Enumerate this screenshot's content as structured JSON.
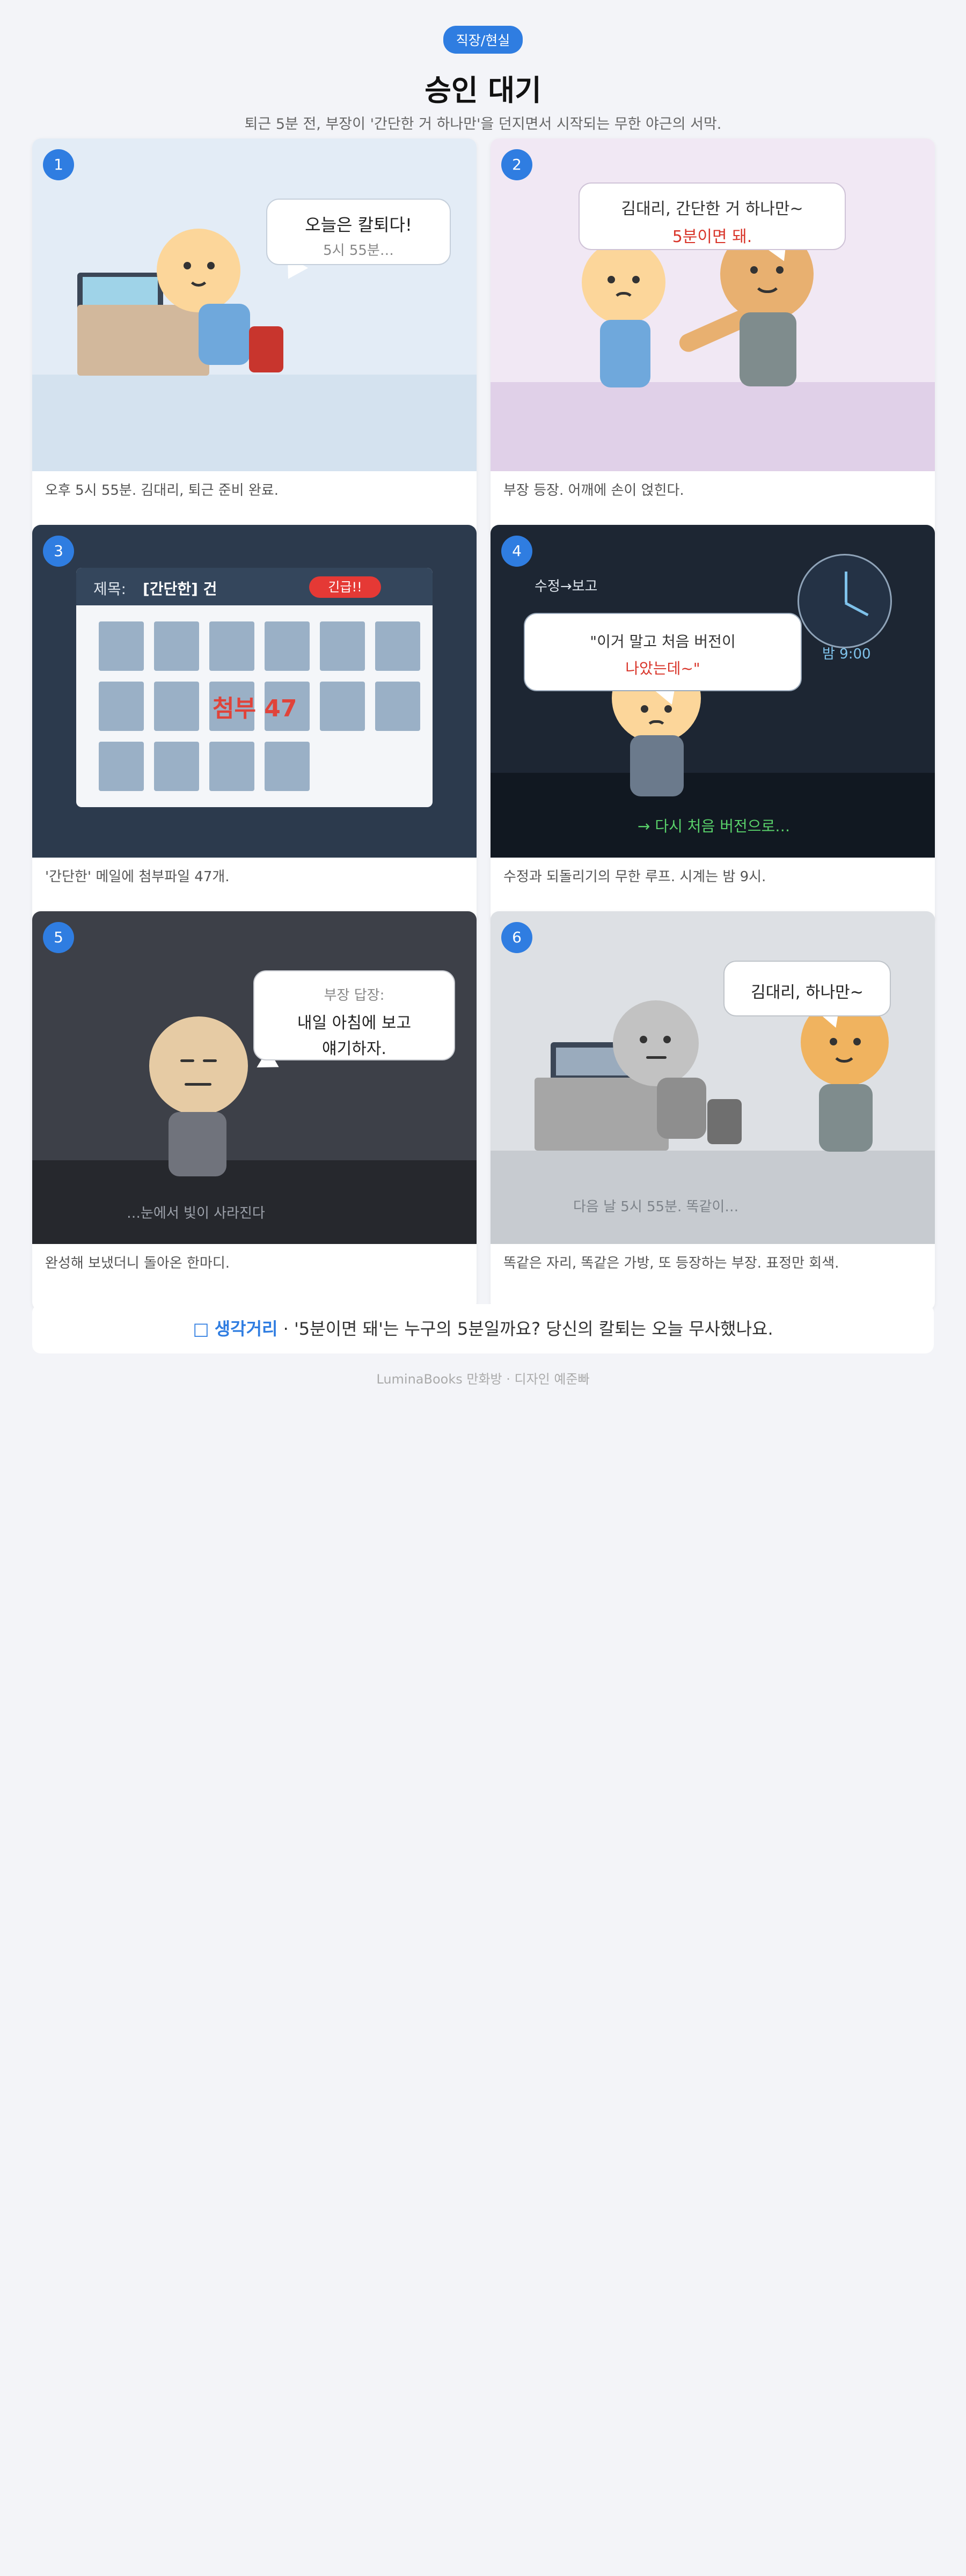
{
  "header": {
    "badge": "직장/현실",
    "title": "승인 대기",
    "subtitle": "퇴근 5분 전, 부장이 '간단한 거 하나만'을 던지면서 시작되는 무한 야근의 서막."
  },
  "panels": [
    {
      "number": "1",
      "bubble_line1": "오늘은 칼퇴다!",
      "bubble_line2": "5시 55분…",
      "caption": "오후 5시 55분. 김대리, 퇴근 준비 완료."
    },
    {
      "number": "2",
      "bubble_line1": "김대리, 간단한 거 하나만~",
      "bubble_line2": "5분이면 돼.",
      "caption": "부장 등장. 어깨에 손이 얹힌다."
    },
    {
      "number": "3",
      "mail_subject_label": "제목:",
      "mail_subject_value": "[간단한] 건",
      "urgent_badge": "긴급!!",
      "attachment_text": "첨부 47",
      "caption": "'간단한' 메일에 첨부파일 47개."
    },
    {
      "number": "4",
      "loop_label": "수정→보고",
      "bubble_line1": "\"이거 말고 처음 버전이",
      "bubble_line2": "나았는데~\"",
      "clock_text": "밤 9:00",
      "bottom_text": "→ 다시 처음 버전으로…",
      "caption": "수정과 되돌리기의 무한 루프. 시계는 밤 9시."
    },
    {
      "number": "5",
      "bubble_header": "부장 답장:",
      "bubble_line1": "내일 아침에 보고",
      "bubble_line2": "얘기하자.",
      "bottom_text": "…눈에서 빛이 사라진다",
      "caption": "완성해 보냈더니 돌아온 한마디."
    },
    {
      "number": "6",
      "bubble_line1": "김대리, 하나만~",
      "bottom_text": "다음 날 5시 55분. 똑같이…",
      "caption": "똑같은 자리, 똑같은 가방, 또 등장하는 부장. 표정만 회색."
    }
  ],
  "note": {
    "icon": "bulb-icon",
    "highlight": "생각거리",
    "text": " · '5분이면 돼'는 누구의 5분일까요? 당신의 칼퇴는 오늘 무사했나요."
  },
  "footer": "LuminaBooks 만화방 · 디자인 예준빠",
  "colors": {
    "accent": "#2f7de1",
    "urgent": "#e53935",
    "success": "#4caf50"
  }
}
